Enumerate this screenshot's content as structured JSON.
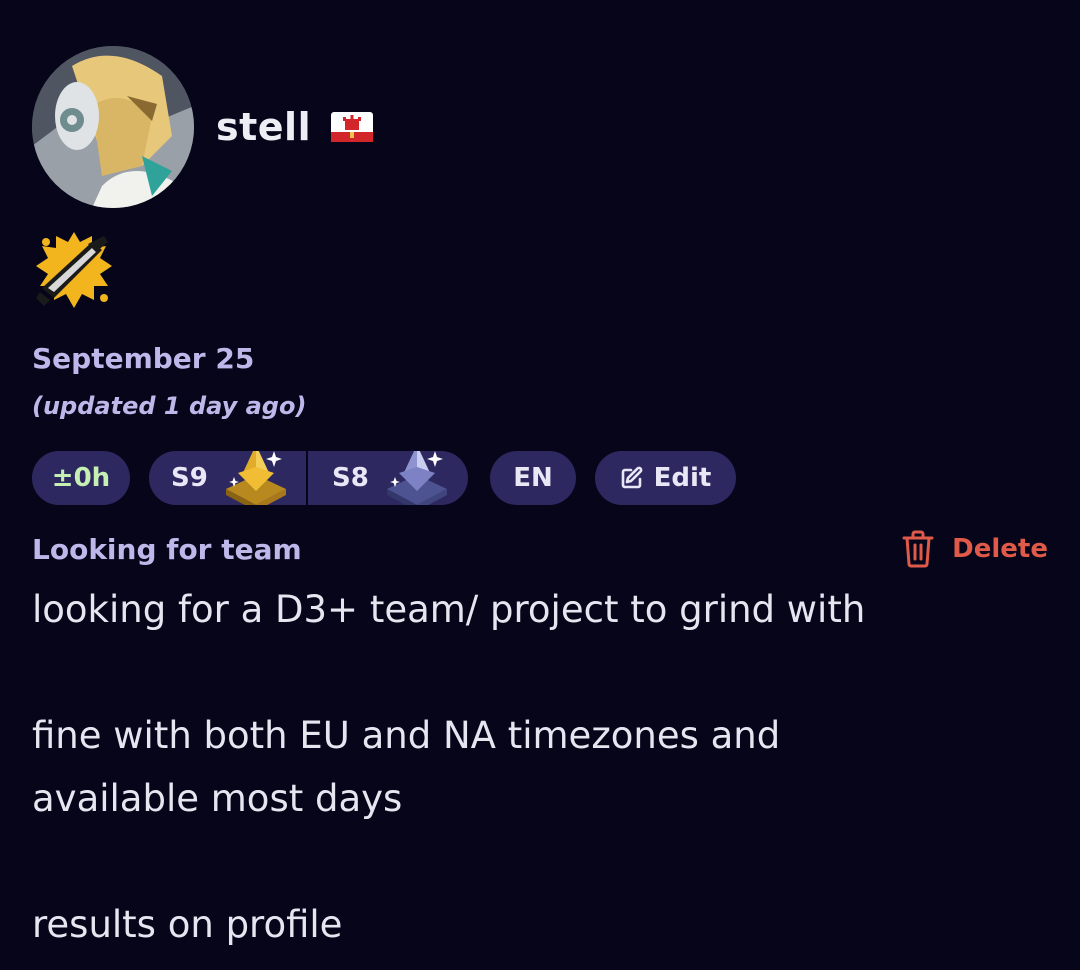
{
  "profile": {
    "username": "stell",
    "flag_icon": "gibraltar-flag-icon",
    "avatar_icon": "avatar-image",
    "weapon_icon": "splattershot-weapon-icon"
  },
  "post": {
    "date": "September 25",
    "updated": "(updated 1 day ago)",
    "timezone_offset": "±0h",
    "ranks": [
      {
        "season": "S9",
        "badge_icon": "gold-diamond-rank-badge-icon"
      },
      {
        "season": "S8",
        "badge_icon": "silver-diamond-rank-badge-icon"
      }
    ],
    "language": "EN",
    "edit_label": "Edit",
    "delete_label": "Delete",
    "type_label": "Looking for team",
    "message_lines": [
      "looking for a D3+ team/ project to grind with",
      "",
      "fine with both EU and NA timezones and",
      "available most days",
      "",
      "results on profile"
    ]
  },
  "colors": {
    "background": "#06051a",
    "pill": "#2e2860",
    "muted_text": "#bcb8ea",
    "timezone_text": "#c6f0b3",
    "delete": "#e05a49"
  }
}
